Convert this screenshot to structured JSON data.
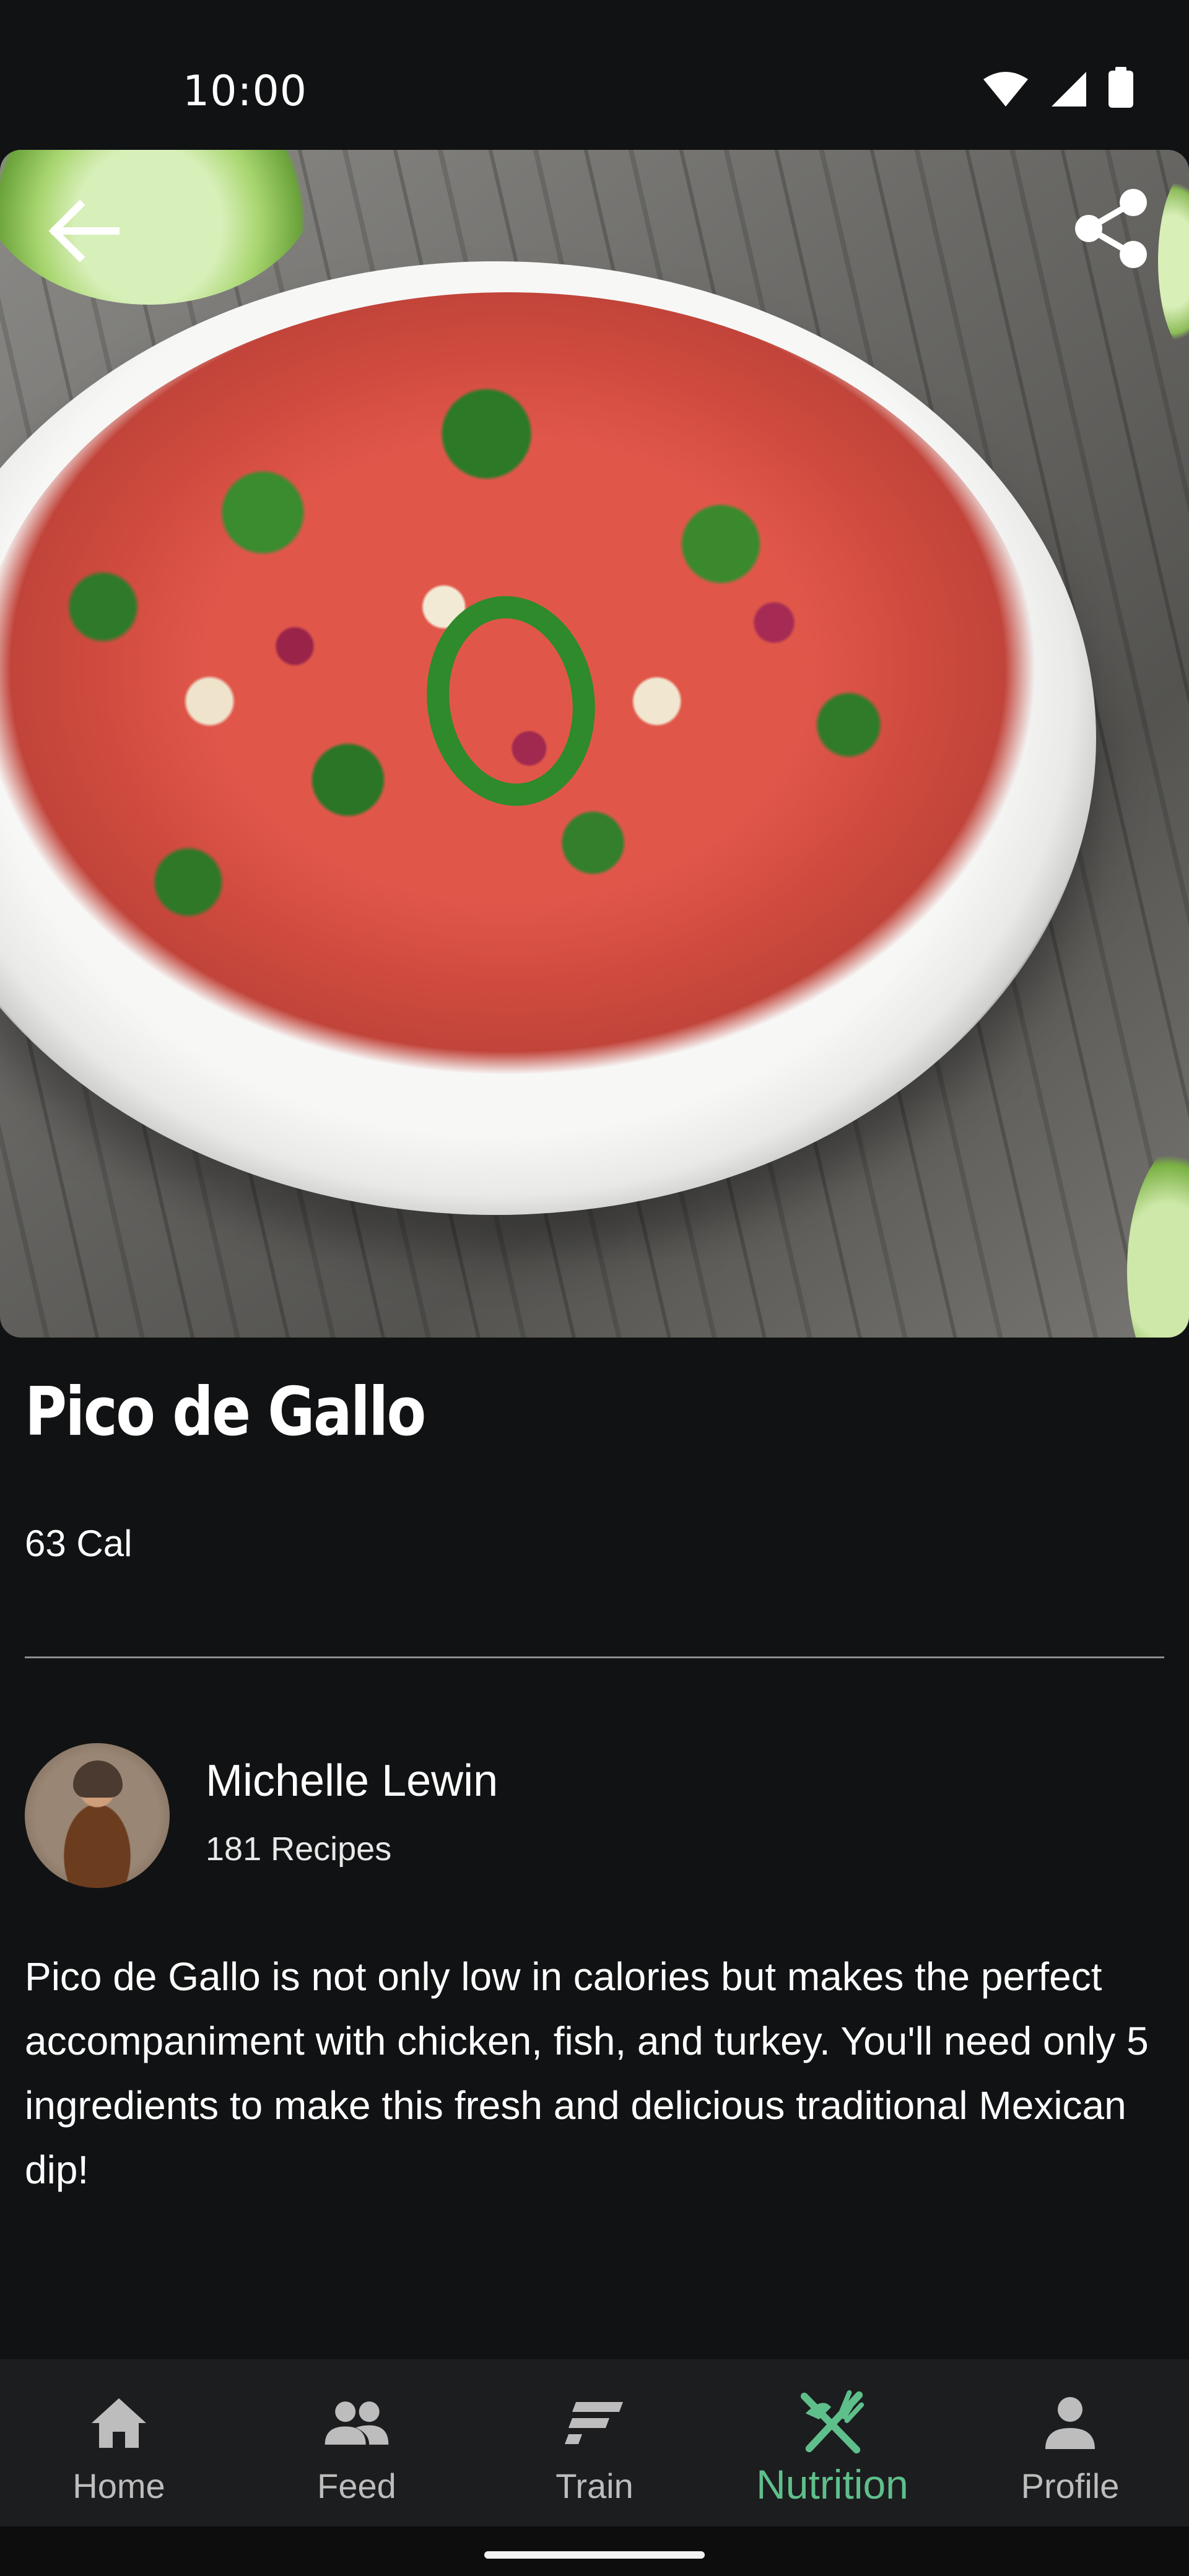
{
  "status_bar": {
    "time": "10:00",
    "icons": [
      "wifi-icon",
      "signal-icon",
      "battery-icon"
    ]
  },
  "hero": {
    "image": "pico-de-gallo-photo",
    "back_icon": "arrow-left-icon",
    "share_icon": "share-icon"
  },
  "recipe": {
    "title": "Pico de Gallo",
    "calories": "63 Cal",
    "description": "Pico de Gallo is not only low in calories but makes the perfect accompaniment with chicken, fish, and turkey. You'll need only 5 ingredients to make this fresh and delicious traditional Mexican dip!"
  },
  "author": {
    "name": "Michelle Lewin",
    "recipes": "181 Recipes"
  },
  "bottom_nav": {
    "items": [
      {
        "label": "Home",
        "icon": "home-icon",
        "active": false
      },
      {
        "label": "Feed",
        "icon": "people-icon",
        "active": false
      },
      {
        "label": "Train",
        "icon": "train-icon",
        "active": false
      },
      {
        "label": "Nutrition",
        "icon": "fork-knife-icon",
        "active": true
      },
      {
        "label": "Profile",
        "icon": "person-icon",
        "active": false
      }
    ]
  },
  "colors": {
    "background": "#111213",
    "nav_background": "#1c1d1f",
    "accent": "#5fbf8b",
    "inactive": "#bdbdbd"
  }
}
